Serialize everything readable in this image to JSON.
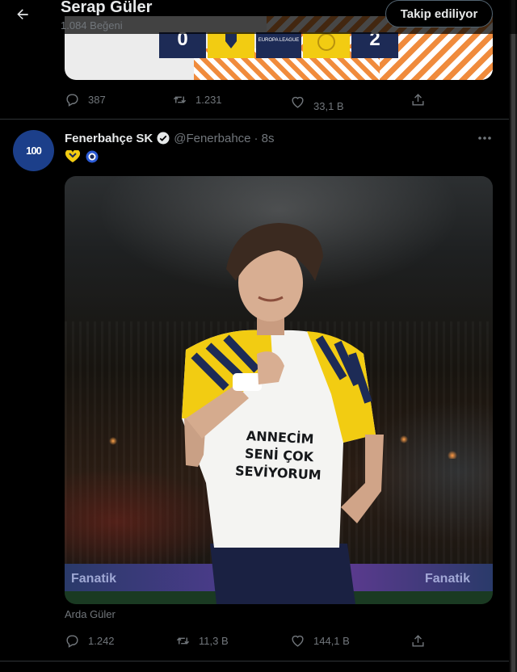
{
  "header": {
    "title": "Serap Güler",
    "subtitle": "1.084 Beğeni",
    "follow_label": "Takip ediliyor"
  },
  "prev_tweet": {
    "media": {
      "home_score": "0",
      "away_score": "2",
      "league_badge": "EUROPA LEAGUE"
    },
    "actions": {
      "reply_count": "387",
      "retweet_count": "1.231",
      "like_count": "33,1 B"
    }
  },
  "tweet": {
    "avatar_text": "100",
    "name": "Fenerbahçe SK",
    "handle": "@Fenerbahce",
    "time": "· 8s",
    "shirt_text": [
      "ANNECİM",
      "SENİ ÇOK",
      "SEVİYORUM"
    ],
    "board_text": [
      "Fanatik",
      "Fanatik"
    ],
    "caption": "Arda Güler",
    "actions": {
      "reply_count": "1.242",
      "retweet_count": "11,3 B",
      "like_count": "144,1 B"
    }
  },
  "colors": {
    "background": "#000000",
    "text_primary": "#e7e9ea",
    "text_secondary": "#71767b",
    "divider": "#2f3336",
    "verified": "#e7e9ea",
    "kit_navy": "#1d2b56",
    "kit_yellow": "#f2cc12"
  },
  "icons": {
    "back": "arrow-left-icon",
    "verified": "verified-badge-icon",
    "more": "more-horizontal-icon",
    "reply": "reply-icon",
    "retweet": "retweet-icon",
    "like": "heart-icon",
    "share": "share-icon",
    "emoji_1": "yellow-heart-emoji",
    "emoji_2": "navy-heart-emoji"
  }
}
